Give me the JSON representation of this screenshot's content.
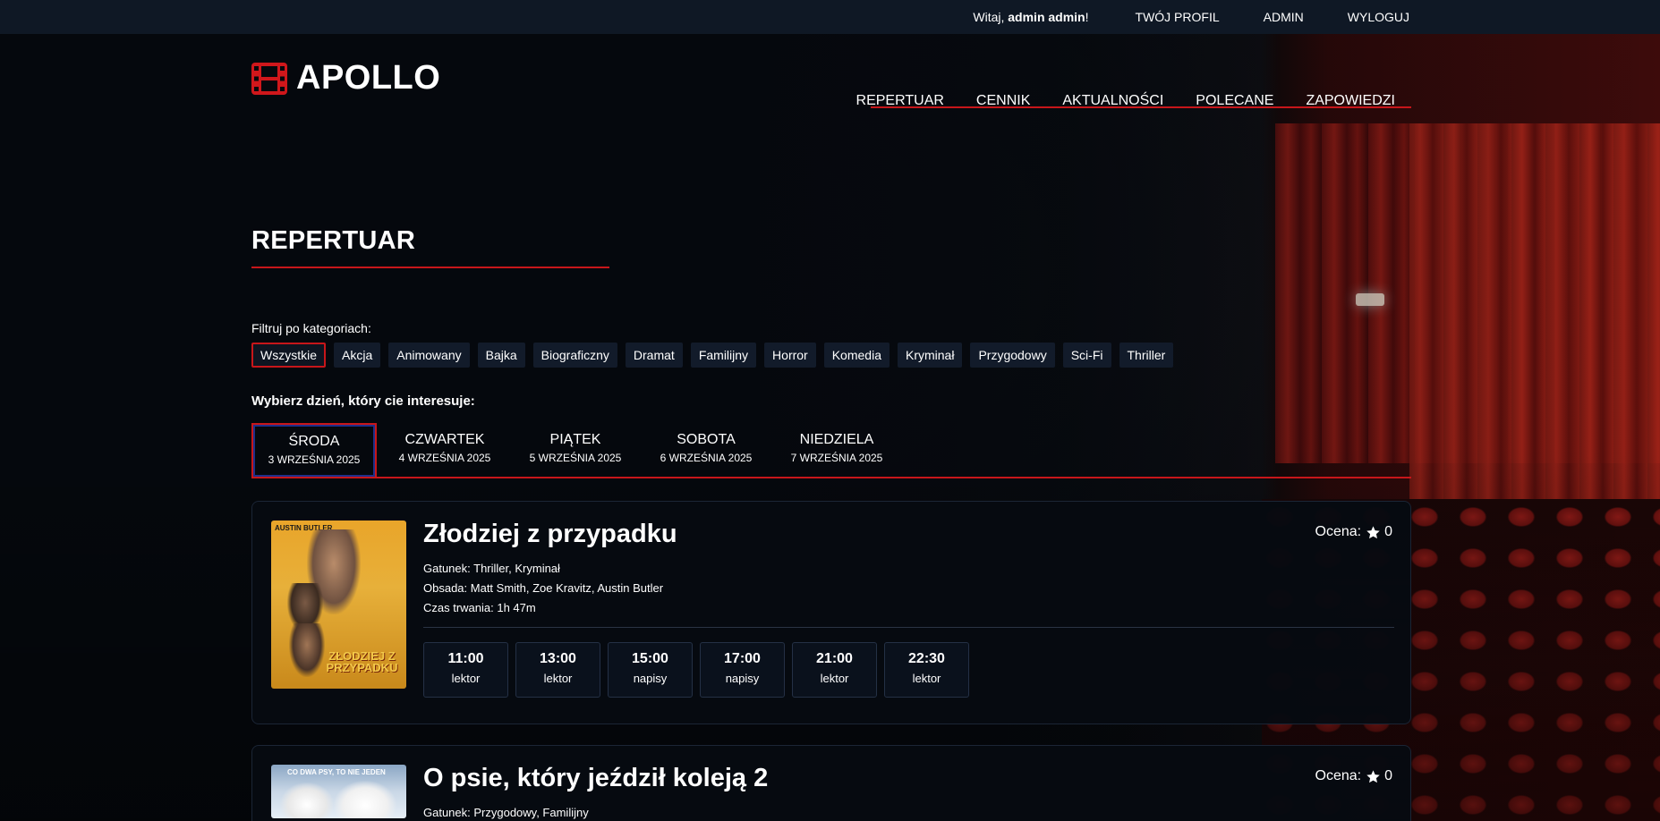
{
  "topbar": {
    "greeting_prefix": "Witaj, ",
    "user_name": "admin admin",
    "greeting_suffix": "!",
    "links": [
      "TWÓJ PROFIL",
      "ADMIN",
      "WYLOGUJ"
    ]
  },
  "logo": {
    "text": "APOLLO",
    "icon": "film-icon"
  },
  "nav": {
    "items": [
      "REPERTUAR",
      "CENNIK",
      "AKTUALNOŚCI",
      "POLECANE",
      "ZAPOWIEDZI"
    ]
  },
  "page_title": "REPERTUAR",
  "filter": {
    "label": "Filtruj po kategoriach:",
    "categories": [
      "Wszystkie",
      "Akcja",
      "Animowany",
      "Bajka",
      "Biograficzny",
      "Dramat",
      "Familijny",
      "Horror",
      "Komedia",
      "Kryminał",
      "Przygodowy",
      "Sci-Fi",
      "Thriller"
    ],
    "active": "Wszystkie"
  },
  "days": {
    "label": "Wybierz dzień, który cie interesuje:",
    "items": [
      {
        "name": "ŚRODA",
        "date": "3 WRZEŚNIA 2025"
      },
      {
        "name": "CZWARTEK",
        "date": "4 WRZEŚNIA 2025"
      },
      {
        "name": "PIĄTEK",
        "date": "5 WRZEŚNIA 2025"
      },
      {
        "name": "SOBOTA",
        "date": "6 WRZEŚNIA 2025"
      },
      {
        "name": "NIEDZIELA",
        "date": "7 WRZEŚNIA 2025"
      }
    ],
    "active": "ŚRODA"
  },
  "movies": [
    {
      "title": "Złodziej z przypadku",
      "rating_label": "Ocena:",
      "rating": "0",
      "genre": "Gatunek: Thriller, Kryminał",
      "cast": "Obsada: Matt Smith, Zoe Kravitz, Austin Butler",
      "duration": "Czas trwania: 1h 47m",
      "poster_top": "AUSTIN BUTLER",
      "poster_title": "ZŁODZIEJ Z PRZYPADKU",
      "showtimes": [
        {
          "time": "11:00",
          "version": "lektor"
        },
        {
          "time": "13:00",
          "version": "lektor"
        },
        {
          "time": "15:00",
          "version": "napisy"
        },
        {
          "time": "17:00",
          "version": "napisy"
        },
        {
          "time": "21:00",
          "version": "lektor"
        },
        {
          "time": "22:30",
          "version": "lektor"
        }
      ]
    },
    {
      "title": "O psie, który jeździł koleją 2",
      "rating_label": "Ocena:",
      "rating": "0",
      "genre": "Gatunek: Przygodowy, Familijny",
      "poster_top": "CO DWA PSY, TO NIE JEDEN"
    }
  ],
  "colors": {
    "accent": "#c7161a",
    "topbar_bg": "#0f1825",
    "chip_bg": "#121b2a"
  }
}
